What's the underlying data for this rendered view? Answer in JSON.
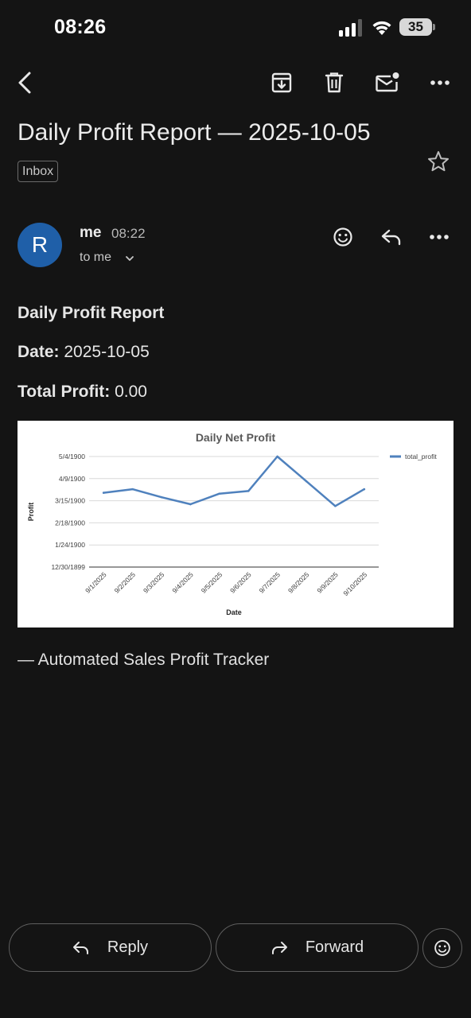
{
  "status_bar": {
    "time": "08:26",
    "battery": "35"
  },
  "toolbar": {
    "icons": [
      "back-icon",
      "archive-icon",
      "delete-icon",
      "mark-unread-icon",
      "more-icon"
    ]
  },
  "email": {
    "subject": "Daily Profit Report — 2025-10-05",
    "label": "Inbox",
    "sender": {
      "initial": "R",
      "name": "me",
      "time": "08:22",
      "recipient": "to me",
      "avatar_color": "#1f5fa8"
    },
    "body": {
      "heading": "Daily Profit Report",
      "date_label": "Date:",
      "date_value": "2025-10-05",
      "profit_label": "Total Profit:",
      "profit_value": "0.00",
      "signature": "— Automated Sales Profit Tracker"
    }
  },
  "chart_data": {
    "type": "line",
    "title": "Daily Net Profit",
    "xlabel": "Date",
    "ylabel": "Profit",
    "categories": [
      "9/1/2025",
      "9/2/2025",
      "9/3/2025",
      "9/4/2025",
      "9/5/2025",
      "9/6/2025",
      "9/7/2025",
      "9/8/2025",
      "9/9/2025",
      "9/10/2025"
    ],
    "series": [
      {
        "name": "total_profit",
        "color": "#4f81bd",
        "values": [
          84,
          88,
          79,
          71,
          83,
          86,
          125,
          97,
          69,
          88
        ]
      }
    ],
    "y_ticks": [
      {
        "value": 0,
        "label": "12/30/1899"
      },
      {
        "value": 25,
        "label": "1/24/1900"
      },
      {
        "value": 50,
        "label": "2/18/1900"
      },
      {
        "value": 75,
        "label": "3/15/1900"
      },
      {
        "value": 100,
        "label": "4/9/1900"
      },
      {
        "value": 125,
        "label": "5/4/1900"
      }
    ],
    "ylim": [
      0,
      125
    ],
    "grid": true,
    "legend_position": "right"
  },
  "actions": {
    "reply": "Reply",
    "forward": "Forward"
  }
}
